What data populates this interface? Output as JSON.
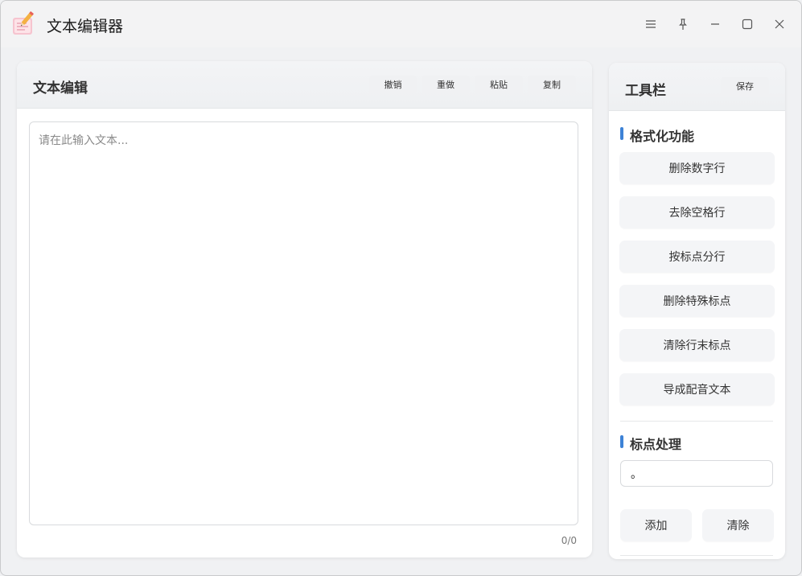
{
  "app": {
    "title": "文本编辑器",
    "icon": "notepad-pencil-icon"
  },
  "window_controls": [
    "menu-icon",
    "pin-icon",
    "minimize-icon",
    "maximize-icon",
    "close-icon"
  ],
  "editor_panel": {
    "title": "文本编辑",
    "buttons": {
      "undo": "撤销",
      "redo": "重做",
      "paste": "粘贴",
      "copy": "复制"
    },
    "textarea": {
      "value": "",
      "placeholder": "请在此输入文本..."
    },
    "counter": "0/0"
  },
  "toolbar_panel": {
    "title": "工具栏",
    "save_label": "保存",
    "format_section": {
      "title": "格式化功能",
      "buttons": [
        "删除数字行",
        "去除空格行",
        "按标点分行",
        "删除特殊标点",
        "清除行末标点",
        "导成配音文本"
      ]
    },
    "punct_section": {
      "title": "标点处理",
      "input_value": "。",
      "add_label": "添加",
      "clear_label": "清除"
    }
  },
  "colors": {
    "accent": "#3d82d6",
    "background": "#f0f1f3",
    "card": "#ffffff"
  }
}
